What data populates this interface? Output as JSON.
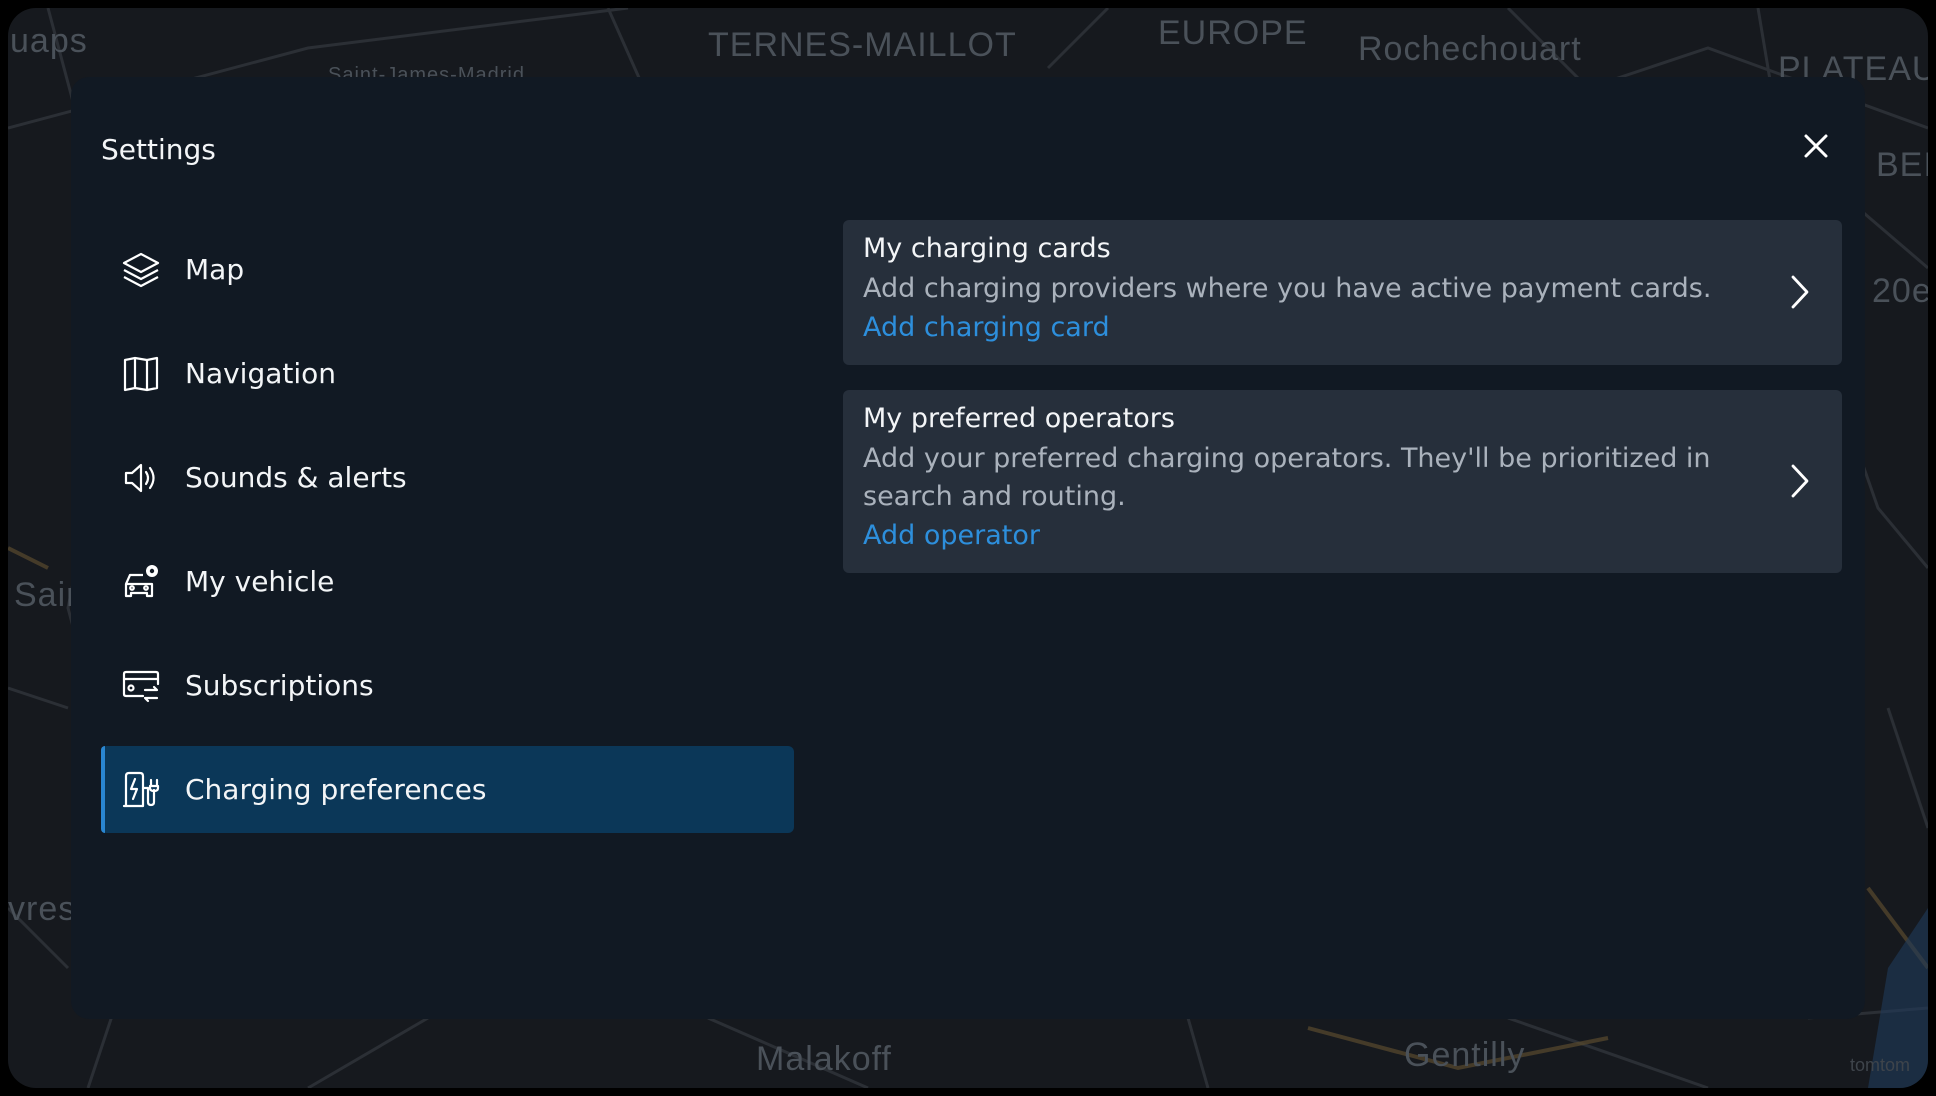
{
  "map": {
    "labels": [
      "uaps",
      "TERNES-MAILLOT",
      "EUROPE",
      "Rochechouart",
      "PLATEAU",
      "BEI",
      "20e",
      "Sair",
      "vres",
      "Malakoff",
      "Gentilly",
      "Saint-James-Madrid"
    ],
    "watermark": "tomtom"
  },
  "settings": {
    "title": "Settings",
    "close_icon": "close-icon"
  },
  "nav": {
    "items": [
      {
        "label": "Map",
        "icon": "layers-icon"
      },
      {
        "label": "Navigation",
        "icon": "map-icon"
      },
      {
        "label": "Sounds & alerts",
        "icon": "speaker-icon"
      },
      {
        "label": "My vehicle",
        "icon": "vehicle-settings-icon"
      },
      {
        "label": "Subscriptions",
        "icon": "subscription-card-icon"
      },
      {
        "label": "Charging preferences",
        "icon": "charging-station-icon"
      }
    ],
    "active": "Charging preferences"
  },
  "cards": [
    {
      "title": "My charging cards",
      "description": "Add charging providers where you have active payment cards.",
      "link": "Add charging card"
    },
    {
      "title": "My preferred operators",
      "description": "Add your preferred charging operators. They'll be prioritized in search and routing.",
      "link": "Add operator"
    }
  ],
  "colors": {
    "panel": "#111923",
    "card": "#262f3b",
    "active_item": "#0b3758",
    "accent": "#2a86d1",
    "link": "#2d8fdc"
  }
}
